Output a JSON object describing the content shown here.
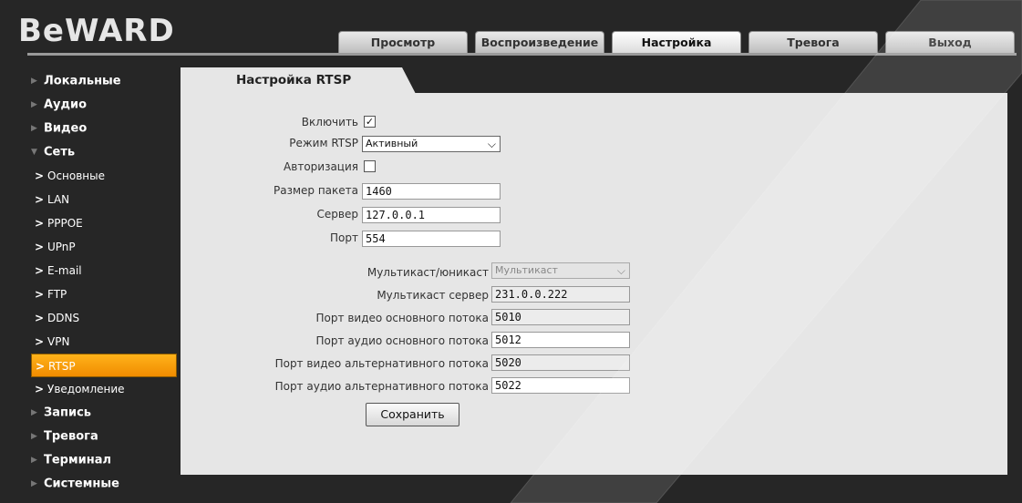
{
  "brand": {
    "logo": "BeWARD"
  },
  "tabs": [
    {
      "label": "Просмотр"
    },
    {
      "label": "Воспроизведение"
    },
    {
      "label": "Настройка"
    },
    {
      "label": "Тревога"
    },
    {
      "label": "Выход"
    }
  ],
  "sidebar": {
    "items": [
      {
        "label": "Локальные"
      },
      {
        "label": "Аудио"
      },
      {
        "label": "Видео"
      },
      {
        "label": "Сеть"
      },
      {
        "label": "Основные"
      },
      {
        "label": "LAN"
      },
      {
        "label": "PPPOE"
      },
      {
        "label": "UPnP"
      },
      {
        "label": "E-mail"
      },
      {
        "label": "FTP"
      },
      {
        "label": "DDNS"
      },
      {
        "label": "VPN"
      },
      {
        "label": "RTSP"
      },
      {
        "label": "Уведомление"
      },
      {
        "label": "Запись"
      },
      {
        "label": "Тревога"
      },
      {
        "label": "Терминал"
      },
      {
        "label": "Системные"
      }
    ]
  },
  "panel": {
    "title": "Настройка RTSP"
  },
  "form": {
    "enable_label": "Включить",
    "enable_checked": "✓",
    "mode_label": "Режим RTSP",
    "mode_value": "Активный",
    "auth_label": "Авторизация",
    "packet_label": "Размер пакета",
    "packet_value": "1460",
    "server_label": "Сервер",
    "server_value": "127.0.0.1",
    "port_label": "Порт",
    "port_value": "554",
    "cast_label": "Мультикаст/юникаст",
    "cast_value": "Мультикаст",
    "mcast_server_label": "Мультикаст сервер",
    "mcast_server_value": "231.0.0.222",
    "vmain_label": "Порт видео основного потока",
    "vmain_value": "5010",
    "amain_label": "Порт аудио основного потока",
    "amain_value": "5012",
    "valt_label": "Порт видео альтернативного потока",
    "valt_value": "5020",
    "aalt_label": "Порт аудио альтернативного потока",
    "aalt_value": "5022",
    "save_label": "Сохранить"
  },
  "colors": {
    "background": "#262626",
    "panel": "#e6e6e6",
    "active_menu": "#f5a000"
  }
}
